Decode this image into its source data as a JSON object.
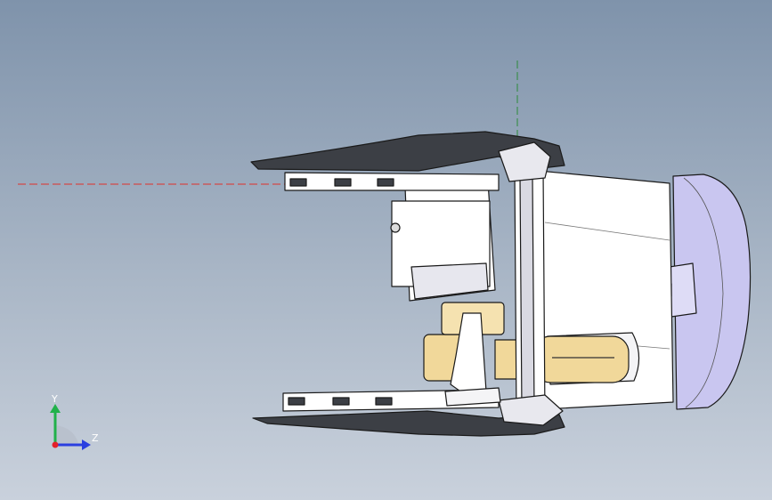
{
  "triad": {
    "y_label": "Y",
    "z_label": "Z"
  },
  "colors": {
    "background_top": "#7f93ab",
    "background_bottom": "#c9d1dc",
    "housing": "#ffffff",
    "cap": "#c9c6f0",
    "motor_parts": "#f1d89a",
    "edges": "#1a1a1a",
    "x_axis_line": "#e0302a",
    "y_axis_line": "#2c8a3a",
    "triad_y": "#21b14a",
    "triad_z": "#2b3fe0",
    "triad_x": "#e4202a"
  }
}
